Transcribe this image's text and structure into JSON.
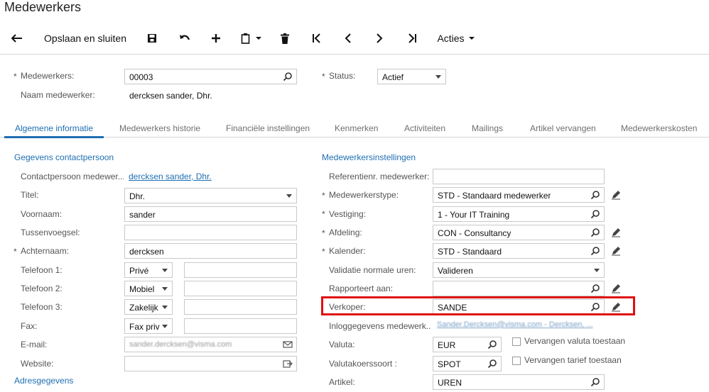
{
  "page": {
    "title": "Medewerkers"
  },
  "toolbar": {
    "back_icon": "arrow-left-icon",
    "save_close_label": "Opslaan en sluiten",
    "save_icon": "floppy-disk-icon",
    "undo_icon": "undo-icon",
    "add_icon": "plus-icon",
    "clipboard_icon": "clipboard-icon",
    "delete_icon": "trash-icon",
    "first_icon": "first-page-icon",
    "prev_icon": "chevron-left-icon",
    "next_icon": "chevron-right-icon",
    "last_icon": "last-page-icon",
    "actions_label": "Acties"
  },
  "header": {
    "employee_label": "Medewerkers:",
    "employee_value": "00003",
    "name_label": "Naam medewerker:",
    "name_value": "dercksen sander, Dhr.",
    "status_label": "Status:",
    "status_value": "Actief"
  },
  "tabs": [
    {
      "label": "Algemene informatie",
      "active": true
    },
    {
      "label": "Medewerkers historie"
    },
    {
      "label": "Financiële instellingen"
    },
    {
      "label": "Kenmerken"
    },
    {
      "label": "Activiteiten"
    },
    {
      "label": "Mailings"
    },
    {
      "label": "Artikel vervangen"
    },
    {
      "label": "Medewerkerskosten"
    }
  ],
  "contact": {
    "section_title": "Gegevens contactpersoon",
    "contact_label": "Contactpersoon medewer...",
    "contact_link": "dercksen sander, Dhr.",
    "title_label": "Titel:",
    "title_value": "Dhr.",
    "firstname_label": "Voornaam:",
    "firstname_value": "sander",
    "middle_label": "Tussenvoegsel:",
    "middle_value": "",
    "lastname_label": "Achternaam:",
    "lastname_value": "dercksen",
    "phone1_label": "Telefoon 1:",
    "phone1_type": "Privé",
    "phone2_label": "Telefoon 2:",
    "phone2_type": "Mobiel",
    "phone3_label": "Telefoon 3:",
    "phone3_type": "Zakelijk",
    "fax_label": "Fax:",
    "fax_type": "Fax priv",
    "email_label": "E-mail:",
    "email_value": "sander.dercksen@visma.com",
    "website_label": "Website:",
    "website_value": "",
    "address_section": "Adresgegevens"
  },
  "settings": {
    "section_title": "Medewerkersinstellingen",
    "ref_label": "Referentienr. medewerker:",
    "ref_value": "",
    "type_label": "Medewerkerstype:",
    "type_value": "STD - Standaard medewerker",
    "branch_label": "Vestiging:",
    "branch_value": "1 - Your IT Training",
    "dept_label": "Afdeling:",
    "dept_value": "CON - Consultancy",
    "calendar_label": "Kalender:",
    "calendar_value": "STD - Standaard",
    "validation_label": "Validatie normale uren:",
    "validation_value": "Valideren",
    "reports_label": "Rapporteert aan:",
    "reports_value": "",
    "sales_label": "Verkoper:",
    "sales_value": "SANDE",
    "login_label": "Inloggegevens medewerk...",
    "login_link": "Sander.Dercksen@visma.com - Dercksen, ...",
    "currency_label": "Valuta:",
    "currency_value": "EUR",
    "currency_override": "Vervangen valuta toestaan",
    "rate_label": "Valutakoerssoort :",
    "rate_value": "SPOT",
    "rate_override": "Vervangen tarief toestaan",
    "article_label": "Artikel:",
    "article_value": "UREN"
  },
  "colors": {
    "accent": "#1f6fb2",
    "highlight": "#e01010"
  }
}
